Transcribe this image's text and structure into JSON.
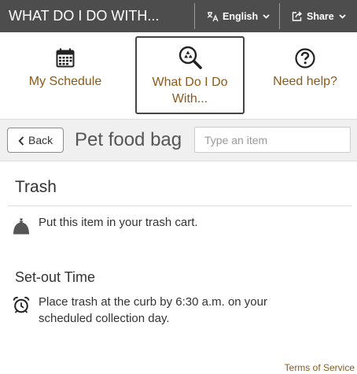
{
  "header": {
    "title": "WHAT DO I DO WITH...",
    "language_label": "English",
    "share_label": "Share"
  },
  "nav": {
    "schedule_label": "My Schedule",
    "whatdo_label": "What Do I Do With...",
    "help_label": "Need help?"
  },
  "search": {
    "back_label": "Back",
    "item_name": "Pet food bag",
    "placeholder": "Type an item"
  },
  "result": {
    "category": "Trash",
    "instruction": "Put this item in your trash cart.",
    "setout_title": "Set-out Time",
    "setout_text": "Place trash at the curb by 6:30 a.m. on your scheduled collection day."
  },
  "footer": {
    "terms_label": "Terms of Service"
  },
  "icons": {
    "language": "translate-icon",
    "share": "share-icon",
    "schedule": "calendar-icon",
    "whatdo": "recycle-search-icon",
    "help": "question-icon",
    "trash": "trash-bag-icon",
    "setout": "alarm-clock-icon"
  },
  "colors": {
    "topbar": "#4d4d4d",
    "accent": "#8a5a1a",
    "searchbar": "#f0f0f0"
  }
}
